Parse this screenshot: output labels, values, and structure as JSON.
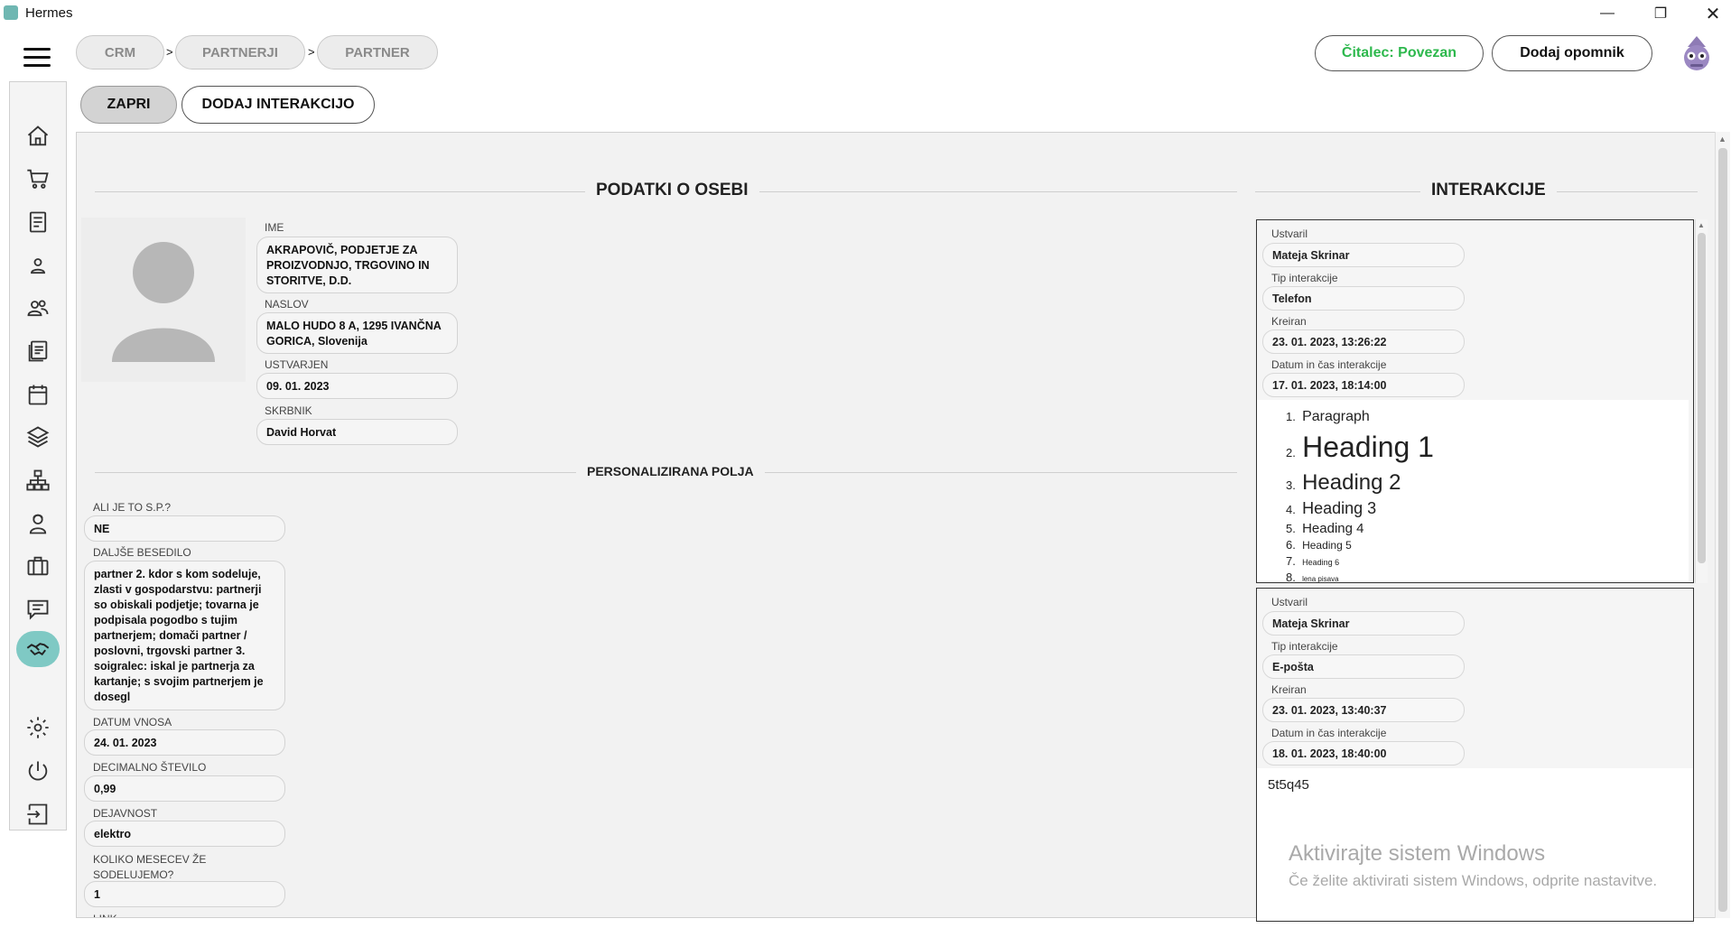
{
  "window": {
    "title": "Hermes"
  },
  "breadcrumb": [
    "CRM",
    "PARTNERJI",
    "PARTNER"
  ],
  "breadcrumb_sep": ">",
  "header": {
    "reader_status": "Čitalec: Povezan",
    "add_reminder": "Dodaj opomnik",
    "reader_status_color": "#2db84d"
  },
  "actions": {
    "close": "ZAPRI",
    "add_interaction": "DODAJ INTERAKCIJO"
  },
  "sidebar_icons": [
    "home-icon",
    "cart-icon",
    "document-icon",
    "person-icon",
    "people-icon",
    "notes-icon",
    "calendar-icon",
    "layers-icon",
    "network-icon",
    "support-person-icon",
    "briefcase-icon",
    "chat-icon",
    "handshake-icon",
    "settings-icon",
    "power-icon",
    "logout-icon"
  ],
  "person": {
    "section_title": "PODATKI O OSEBI",
    "name_label": "IME",
    "name": "AKRAPOVIČ, PODJETJE ZA PROIZVODNJO, TRGOVINO IN STORITVE, D.D.",
    "address_label": "NASLOV",
    "address": "MALO HUDO 8 A, 1295 IVANČNA GORICA, Slovenija",
    "created_label": "USTVARJEN",
    "created": "09. 01. 2023",
    "owner_label": "SKRBNIK",
    "owner": "David Horvat"
  },
  "custom": {
    "section_title": "PERSONALIZIRANA POLJA",
    "sp_label": "ALI JE TO S.P.?",
    "sp_value": "NE",
    "long_text_label": "DALJŠE BESEDILO",
    "long_text": "partner 2. kdor s kom sodeluje, zlasti v gospodarstvu: partnerji so obiskali podjetje; tovarna je podpisala pogodbo s tujim partnerjem; domači partner / poslovni, trgovski partner 3. soigralec: iskal je partnerja za kartanje; s svojim partnerjem je dosegl",
    "entry_date_label": "DATUM VNOSA",
    "entry_date": "24. 01. 2023",
    "decimal_label": "DECIMALNO ŠTEVILO",
    "decimal_value": "0,99",
    "activity_label": "DEJAVNOST",
    "activity_value": "elektro",
    "months_label": "KOLIKO MESECEV ŽE SODELUJEMO?",
    "months_value": "1",
    "next_label_partial": "LINK"
  },
  "interactions": {
    "section_title": "INTERAKCIJE",
    "created_by_label": "Ustvaril",
    "type_label": "Tip interakcije",
    "created_at_label": "Kreiran",
    "datetime_label": "Datum in čas interakcije",
    "items": [
      {
        "created_by": "Mateja Skrinar",
        "type": "Telefon",
        "created_at": "23. 01. 2023, 13:26:22",
        "datetime": "17. 01. 2023, 18:14:00",
        "list": [
          "Paragraph",
          "Heading 1",
          "Heading 2",
          "Heading 3",
          "Heading 4",
          "Heading 5",
          "Heading 6",
          "lena pisava"
        ]
      },
      {
        "created_by": "Mateja Skrinar",
        "type": "E-pošta",
        "created_at": "23. 01. 2023, 13:40:37",
        "datetime": "18. 01. 2023, 18:40:00",
        "body": "5t5q45"
      }
    ]
  },
  "watermark": {
    "line1": "Aktivirajte sistem Windows",
    "line2": "Če želite aktivirati sistem Windows, odprite nastavitve."
  }
}
